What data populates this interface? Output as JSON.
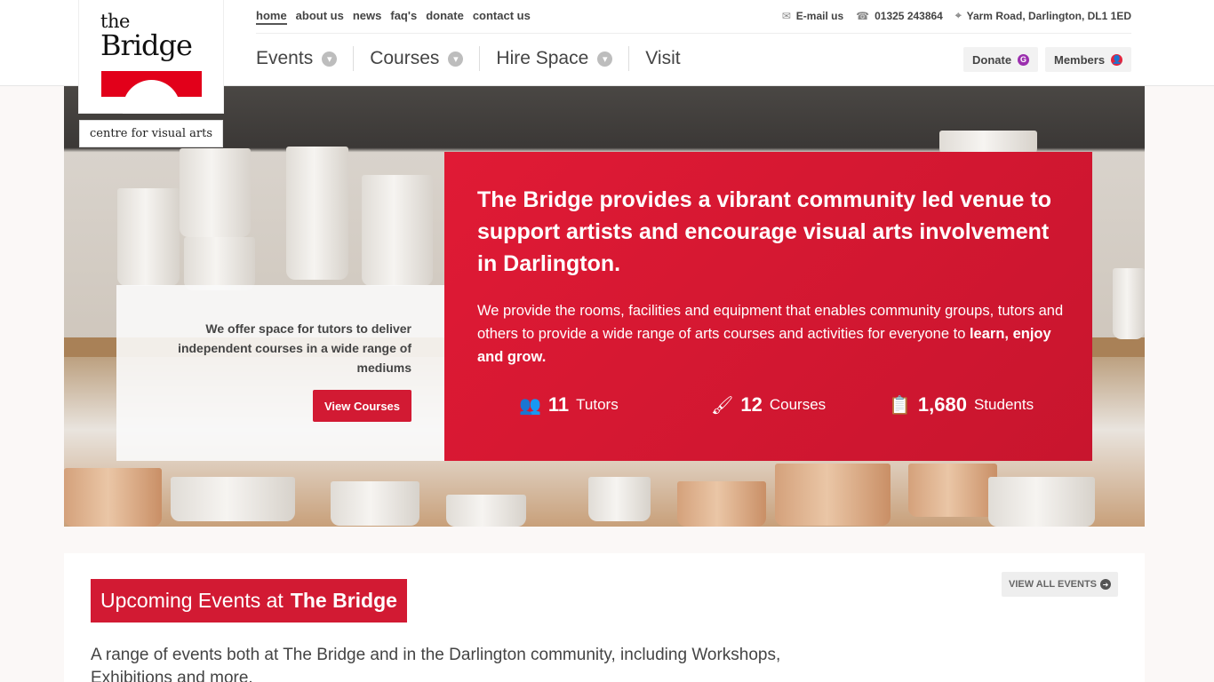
{
  "logo": {
    "line1": "the",
    "line2": "Bridge",
    "tagline": "centre for visual arts"
  },
  "top_links": [
    "home",
    "about us",
    "news",
    "faq's",
    "donate",
    "contact us"
  ],
  "contact": {
    "email_label": "E-mail us",
    "phone": "01325 243864",
    "address": "Yarm Road, Darlington, DL1 1ED"
  },
  "main_nav": [
    {
      "label": "Events",
      "has_dropdown": true
    },
    {
      "label": "Courses",
      "has_dropdown": true
    },
    {
      "label": "Hire Space",
      "has_dropdown": true
    },
    {
      "label": "Visit",
      "has_dropdown": false
    }
  ],
  "header_buttons": {
    "donate": {
      "label": "Donate",
      "badge": "G",
      "badge_color": "#9b2fae"
    },
    "members": {
      "label": "Members",
      "badge": "●",
      "badge_color": "#e2263f"
    }
  },
  "hero": {
    "left_card": {
      "text": "We offer space for tutors to deliver independent courses in a wide range of mediums",
      "button": "View Courses"
    },
    "red_card": {
      "heading": "The Bridge provides a vibrant community led venue to support artists and encourage visual arts involvement in Darlington.",
      "description_prefix": "We provide the rooms, facilities and equipment that enables community groups, tutors and others to provide a wide range of arts courses and activities for everyone to ",
      "description_emphasis": "learn, enjoy and grow.",
      "stats": [
        {
          "icon": "users-icon",
          "number": "11",
          "label": "Tutors"
        },
        {
          "icon": "paintbrush-icon",
          "number": "12",
          "label": "Courses"
        },
        {
          "icon": "clipboard-icon",
          "number": "1,680",
          "label": "Students"
        }
      ]
    }
  },
  "events": {
    "title_prefix": "Upcoming Events at",
    "title_emphasis": "The Bridge",
    "view_all": "VIEW ALL EVENTS",
    "description": "A range of events both at The Bridge and in the Darlington community, including Workshops, Exhibitions and more."
  },
  "colors": {
    "brand_red": "#d21a33",
    "accent_red": "#e2001a"
  }
}
